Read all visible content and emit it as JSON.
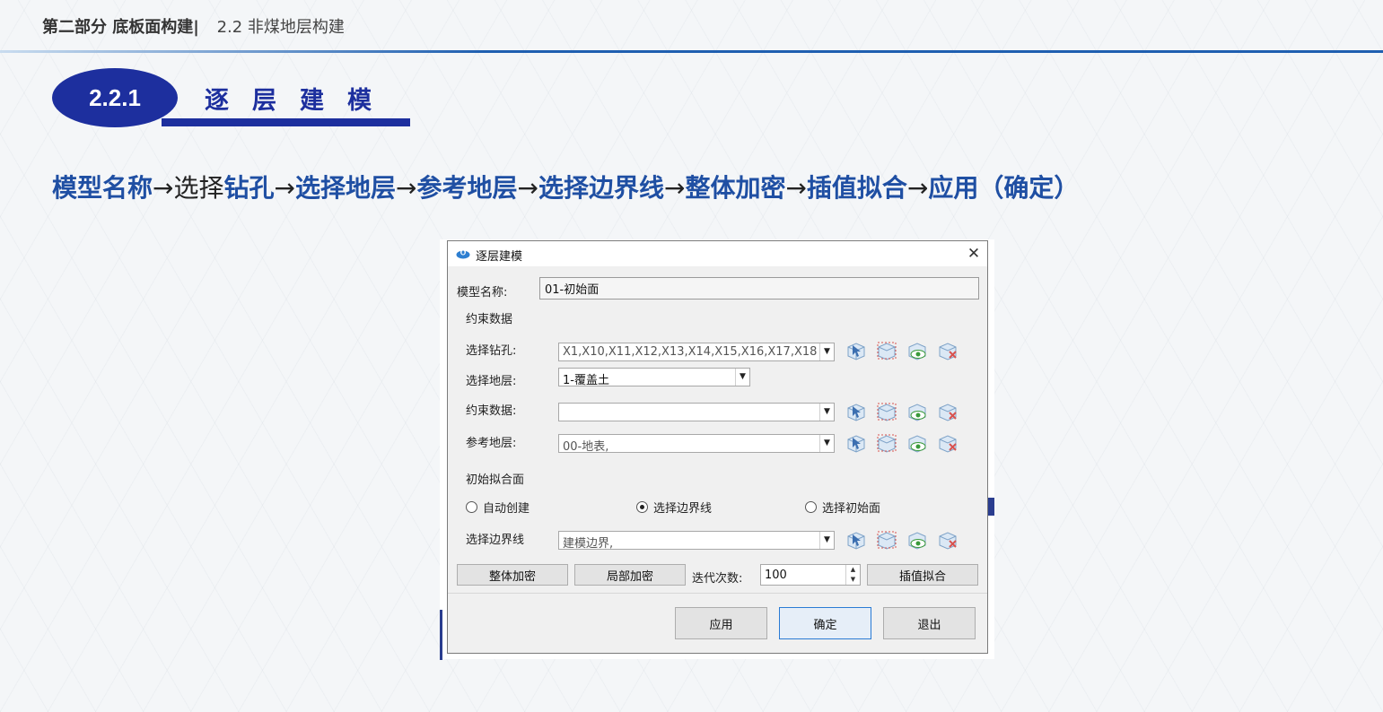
{
  "header": {
    "part": "第二部分 底板面构建|",
    "section": "2.2 非煤地层构建"
  },
  "badge": {
    "number": "2.2.1",
    "title": "逐层建模"
  },
  "flow": {
    "s1": "模型名称",
    "a1": "→",
    "s2a": "选择",
    "s2b": "钻孔",
    "a2": "→",
    "s3": "选择地层",
    "a3": "→",
    "s4": "参考地层",
    "a4": "→",
    "s5": "选择边界线",
    "a5": "→",
    "s6": "整体加密",
    "a6": "→",
    "s7": "插值拟合",
    "a7": "→",
    "s8": "应用（确定）"
  },
  "dialog": {
    "title": "逐层建模",
    "close": "✕",
    "model_name_label": "模型名称:",
    "model_name_value": "01-初始面",
    "constraint_group": "约束数据",
    "borehole_label": "选择钻孔:",
    "borehole_value": "X1,X10,X11,X12,X13,X14,X15,X16,X17,X18",
    "stratum_label": "选择地层:",
    "stratum_value": "1-覆盖土",
    "constraint_label": "约束数据:",
    "constraint_value": "",
    "reference_label": "参考地层:",
    "reference_value": "00-地表,",
    "initial_group": "初始拟合面",
    "radio_auto": "自动创建",
    "radio_boundary": "选择边界线",
    "radio_initial": "选择初始面",
    "boundary_label": "选择边界线",
    "boundary_value": "建模边界,",
    "btn_global": "整体加密",
    "btn_local": "局部加密",
    "iter_label": "迭代次数:",
    "iter_value": "100",
    "btn_interp": "插值拟合",
    "btn_apply": "应用",
    "btn_ok": "确定",
    "btn_exit": "退出"
  },
  "icons": [
    "select-pick-icon",
    "select-box-icon",
    "view-eye-icon",
    "clear-delete-icon"
  ],
  "colors": {
    "accent": "#1d2f9e",
    "flow_blue": "#1f4fa3",
    "header_line": "#1f5fb0"
  }
}
